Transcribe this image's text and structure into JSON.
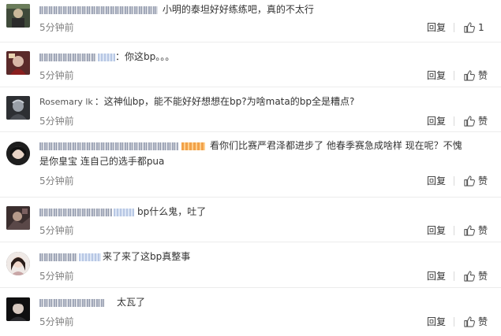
{
  "comments": [
    {
      "id": "c1",
      "text": "小明的泰坦好好练练吧，真的不太行",
      "time": "5分钟前",
      "reply_label": "回复",
      "like_label": "1"
    },
    {
      "id": "c2",
      "text": "：你这bp。。。",
      "time": "5分钟前",
      "reply_label": "回复",
      "like_label": "赞"
    },
    {
      "id": "c3",
      "username": "Rosemary lk",
      "text": "：这神仙bp，能不能好好想想在bp?为啥mata的bp全是糟点?",
      "time": "5分钟前",
      "reply_label": "回复",
      "like_label": "赞"
    },
    {
      "id": "c4",
      "text_line1": "看你们比赛严君泽都进步了 他春季赛急成啥样 现在呢？不愧",
      "text_line2": "是你皇宝 连自己的选手都pua",
      "time": "5分钟前",
      "reply_label": "回复",
      "like_label": "赞"
    },
    {
      "id": "c5",
      "text": "bp什么鬼，吐了",
      "time": "5分钟前",
      "reply_label": "回复",
      "like_label": "赞"
    },
    {
      "id": "c6",
      "text": "来了来了这bp真整事",
      "time": "5分钟前",
      "reply_label": "回复",
      "like_label": "赞"
    },
    {
      "id": "c7",
      "text": "太瓦了",
      "time": "5分钟前",
      "reply_label": "回复",
      "like_label": "赞"
    }
  ],
  "icons": {
    "like": "thumbs-up-icon"
  },
  "colors": {
    "text": "#333333",
    "meta": "#808080",
    "divider": "#ececec"
  }
}
